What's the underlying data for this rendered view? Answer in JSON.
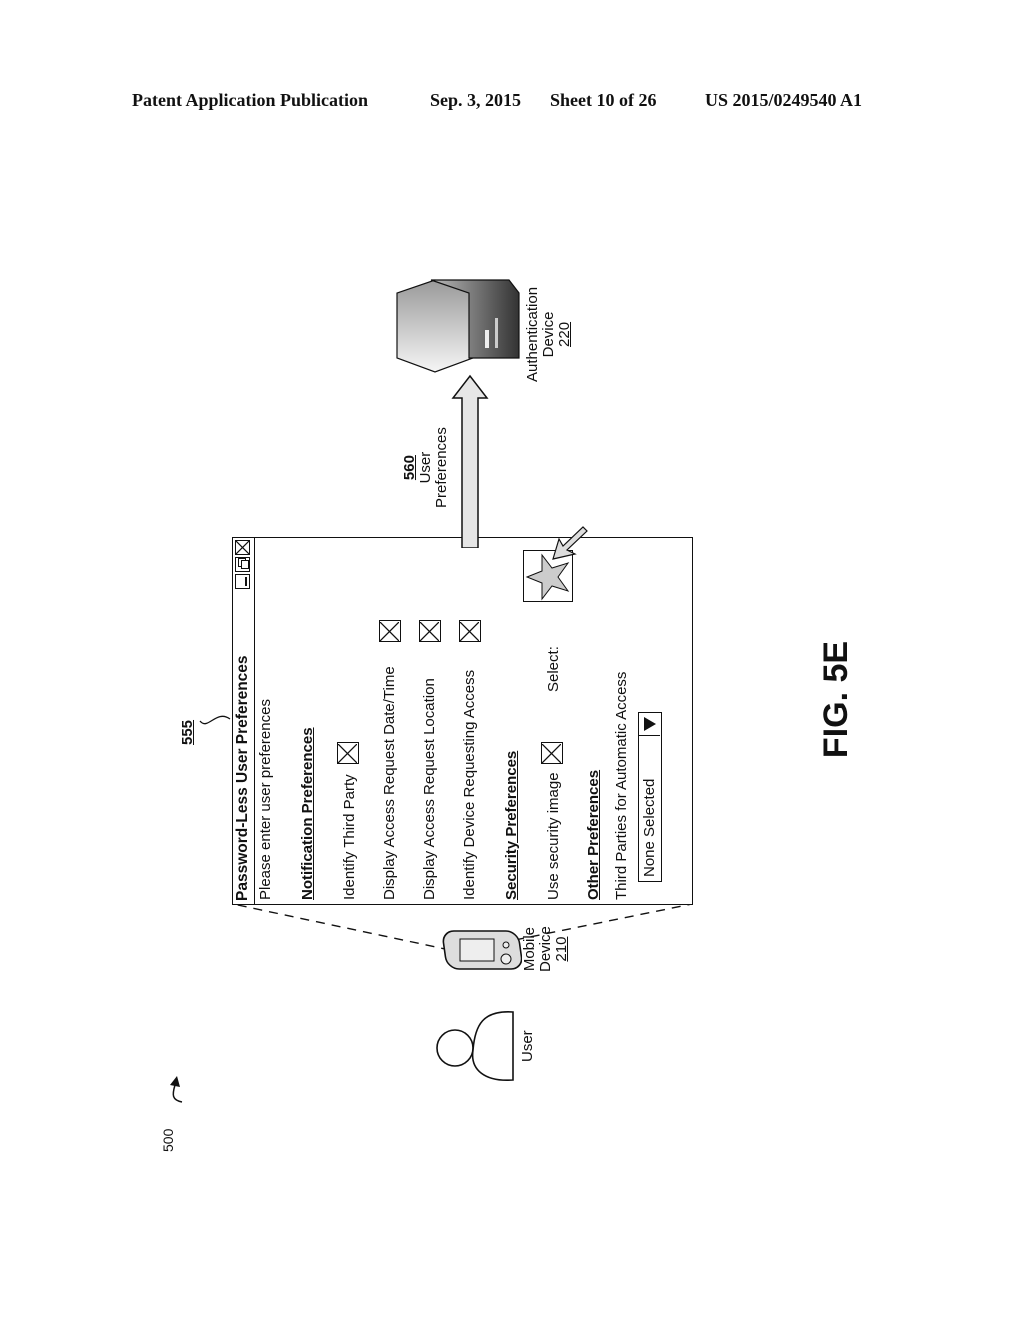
{
  "header": {
    "publication": "Patent Application Publication",
    "date": "Sep. 3, 2015",
    "sheet": "Sheet 10 of 26",
    "number": "US 2015/0249540 A1"
  },
  "figure": {
    "ref_500": "500",
    "label": "FIG. 5E",
    "user_label": "User",
    "mobile": {
      "line1": "Mobile",
      "line2": "Device",
      "ref": "210"
    },
    "auth": {
      "line1": "Authentication",
      "line2": "Device",
      "ref": "220"
    },
    "arrow_560": {
      "ref": "560",
      "line1": "User",
      "line2": "Preferences"
    },
    "dialog_ref": "555"
  },
  "dialog": {
    "title": "Password-Less User Preferences",
    "window_buttons": [
      "minimize-icon",
      "restore-icon",
      "close-icon"
    ],
    "prompt": "Please enter user preferences",
    "sections": [
      {
        "heading": "Notification Preferences",
        "items": [
          {
            "label": "Identify Third Party",
            "checked": true
          },
          {
            "label": "Display Access Request Date/Time",
            "checked": true
          },
          {
            "label": "Display Access Request Location",
            "checked": true
          },
          {
            "label": "Identify Device Requesting Access",
            "checked": true
          }
        ]
      },
      {
        "heading": "Security Preferences",
        "items": [
          {
            "label": "Use security image",
            "checked": true,
            "select_label": "Select:",
            "selected_image": "star-icon"
          }
        ]
      },
      {
        "heading": "Other Preferences",
        "items": [
          {
            "label": "Third Parties for Automatic Access",
            "dropdown_value": "None Selected"
          }
        ]
      }
    ]
  }
}
